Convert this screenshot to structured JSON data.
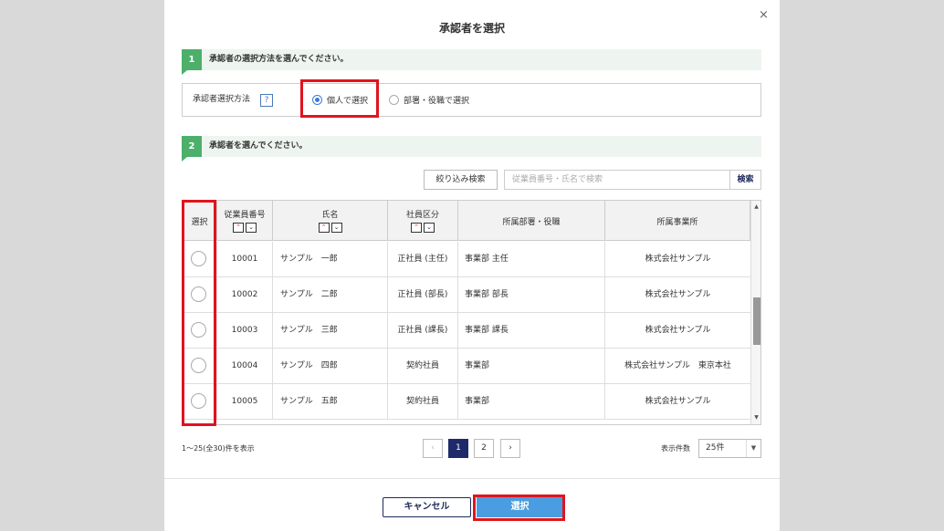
{
  "dialog": {
    "title": "承認者を選択",
    "close_icon": "×"
  },
  "step1": {
    "num": "1",
    "text": "承認者の選択方法を選んでください。"
  },
  "method": {
    "label": "承認者選択方法",
    "help": "?",
    "options": [
      {
        "label": "個人で選択",
        "selected": true
      },
      {
        "label": "部署・役職で選択",
        "selected": false
      }
    ]
  },
  "step2": {
    "num": "2",
    "text": "承認者を選んでください。"
  },
  "search": {
    "filter_label": "絞り込み検索",
    "placeholder": "従業員番号・氏名で検索",
    "button": "検索"
  },
  "table": {
    "headers": {
      "select": "選択",
      "emp_no": "従業員番号",
      "name": "氏名",
      "emp_type": "社員区分",
      "dept": "所属部署・役職",
      "office": "所属事業所"
    },
    "sort_up": "⌃",
    "sort_down": "⌄",
    "rows": [
      {
        "emp_no": "10001",
        "name": "サンプル　一郎",
        "emp_type": "正社員 (主任)",
        "dept": "事業部 主任",
        "office": "株式会社サンプル"
      },
      {
        "emp_no": "10002",
        "name": "サンプル　二郎",
        "emp_type": "正社員 (部長)",
        "dept": "事業部 部長",
        "office": "株式会社サンプル"
      },
      {
        "emp_no": "10003",
        "name": "サンプル　三郎",
        "emp_type": "正社員 (課長)",
        "dept": "事業部 課長",
        "office": "株式会社サンプル"
      },
      {
        "emp_no": "10004",
        "name": "サンプル　四郎",
        "emp_type": "契約社員",
        "dept": "事業部",
        "office": "株式会社サンプル　東京本社"
      },
      {
        "emp_no": "10005",
        "name": "サンプル　五郎",
        "emp_type": "契約社員",
        "dept": "事業部",
        "office": "株式会社サンプル"
      }
    ]
  },
  "pagination": {
    "count_text": "1〜25(全30)件を表示",
    "prev": "‹",
    "pages": [
      "1",
      "2"
    ],
    "next": "›",
    "per_page_label": "表示件数",
    "per_page_value": "25件"
  },
  "footer": {
    "cancel": "キャンセル",
    "select": "選択"
  },
  "colors": {
    "accent_green": "#4caf6a",
    "highlight_red": "#e0141e",
    "primary_navy": "#1e2a6a",
    "select_blue": "#4a9de0"
  }
}
